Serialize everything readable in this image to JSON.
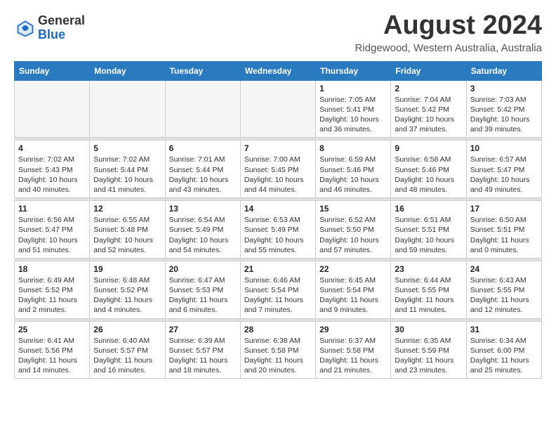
{
  "header": {
    "logo_general": "General",
    "logo_blue": "Blue",
    "month_title": "August 2024",
    "location": "Ridgewood, Western Australia, Australia"
  },
  "weekdays": [
    "Sunday",
    "Monday",
    "Tuesday",
    "Wednesday",
    "Thursday",
    "Friday",
    "Saturday"
  ],
  "weeks": [
    [
      {
        "day": "",
        "info": ""
      },
      {
        "day": "",
        "info": ""
      },
      {
        "day": "",
        "info": ""
      },
      {
        "day": "",
        "info": ""
      },
      {
        "day": "1",
        "info": "Sunrise: 7:05 AM\nSunset: 5:41 PM\nDaylight: 10 hours\nand 36 minutes."
      },
      {
        "day": "2",
        "info": "Sunrise: 7:04 AM\nSunset: 5:42 PM\nDaylight: 10 hours\nand 37 minutes."
      },
      {
        "day": "3",
        "info": "Sunrise: 7:03 AM\nSunset: 5:42 PM\nDaylight: 10 hours\nand 39 minutes."
      }
    ],
    [
      {
        "day": "4",
        "info": "Sunrise: 7:02 AM\nSunset: 5:43 PM\nDaylight: 10 hours\nand 40 minutes."
      },
      {
        "day": "5",
        "info": "Sunrise: 7:02 AM\nSunset: 5:44 PM\nDaylight: 10 hours\nand 41 minutes."
      },
      {
        "day": "6",
        "info": "Sunrise: 7:01 AM\nSunset: 5:44 PM\nDaylight: 10 hours\nand 43 minutes."
      },
      {
        "day": "7",
        "info": "Sunrise: 7:00 AM\nSunset: 5:45 PM\nDaylight: 10 hours\nand 44 minutes."
      },
      {
        "day": "8",
        "info": "Sunrise: 6:59 AM\nSunset: 5:46 PM\nDaylight: 10 hours\nand 46 minutes."
      },
      {
        "day": "9",
        "info": "Sunrise: 6:58 AM\nSunset: 5:46 PM\nDaylight: 10 hours\nand 48 minutes."
      },
      {
        "day": "10",
        "info": "Sunrise: 6:57 AM\nSunset: 5:47 PM\nDaylight: 10 hours\nand 49 minutes."
      }
    ],
    [
      {
        "day": "11",
        "info": "Sunrise: 6:56 AM\nSunset: 5:47 PM\nDaylight: 10 hours\nand 51 minutes."
      },
      {
        "day": "12",
        "info": "Sunrise: 6:55 AM\nSunset: 5:48 PM\nDaylight: 10 hours\nand 52 minutes."
      },
      {
        "day": "13",
        "info": "Sunrise: 6:54 AM\nSunset: 5:49 PM\nDaylight: 10 hours\nand 54 minutes."
      },
      {
        "day": "14",
        "info": "Sunrise: 6:53 AM\nSunset: 5:49 PM\nDaylight: 10 hours\nand 55 minutes."
      },
      {
        "day": "15",
        "info": "Sunrise: 6:52 AM\nSunset: 5:50 PM\nDaylight: 10 hours\nand 57 minutes."
      },
      {
        "day": "16",
        "info": "Sunrise: 6:51 AM\nSunset: 5:51 PM\nDaylight: 10 hours\nand 59 minutes."
      },
      {
        "day": "17",
        "info": "Sunrise: 6:50 AM\nSunset: 5:51 PM\nDaylight: 11 hours\nand 0 minutes."
      }
    ],
    [
      {
        "day": "18",
        "info": "Sunrise: 6:49 AM\nSunset: 5:52 PM\nDaylight: 11 hours\nand 2 minutes."
      },
      {
        "day": "19",
        "info": "Sunrise: 6:48 AM\nSunset: 5:52 PM\nDaylight: 11 hours\nand 4 minutes."
      },
      {
        "day": "20",
        "info": "Sunrise: 6:47 AM\nSunset: 5:53 PM\nDaylight: 11 hours\nand 6 minutes."
      },
      {
        "day": "21",
        "info": "Sunrise: 6:46 AM\nSunset: 5:54 PM\nDaylight: 11 hours\nand 7 minutes."
      },
      {
        "day": "22",
        "info": "Sunrise: 6:45 AM\nSunset: 5:54 PM\nDaylight: 11 hours\nand 9 minutes."
      },
      {
        "day": "23",
        "info": "Sunrise: 6:44 AM\nSunset: 5:55 PM\nDaylight: 11 hours\nand 11 minutes."
      },
      {
        "day": "24",
        "info": "Sunrise: 6:43 AM\nSunset: 5:55 PM\nDaylight: 11 hours\nand 12 minutes."
      }
    ],
    [
      {
        "day": "25",
        "info": "Sunrise: 6:41 AM\nSunset: 5:56 PM\nDaylight: 11 hours\nand 14 minutes."
      },
      {
        "day": "26",
        "info": "Sunrise: 6:40 AM\nSunset: 5:57 PM\nDaylight: 11 hours\nand 16 minutes."
      },
      {
        "day": "27",
        "info": "Sunrise: 6:39 AM\nSunset: 5:57 PM\nDaylight: 11 hours\nand 18 minutes."
      },
      {
        "day": "28",
        "info": "Sunrise: 6:38 AM\nSunset: 5:58 PM\nDaylight: 11 hours\nand 20 minutes."
      },
      {
        "day": "29",
        "info": "Sunrise: 6:37 AM\nSunset: 5:58 PM\nDaylight: 11 hours\nand 21 minutes."
      },
      {
        "day": "30",
        "info": "Sunrise: 6:35 AM\nSunset: 5:59 PM\nDaylight: 11 hours\nand 23 minutes."
      },
      {
        "day": "31",
        "info": "Sunrise: 6:34 AM\nSunset: 6:00 PM\nDaylight: 11 hours\nand 25 minutes."
      }
    ]
  ]
}
